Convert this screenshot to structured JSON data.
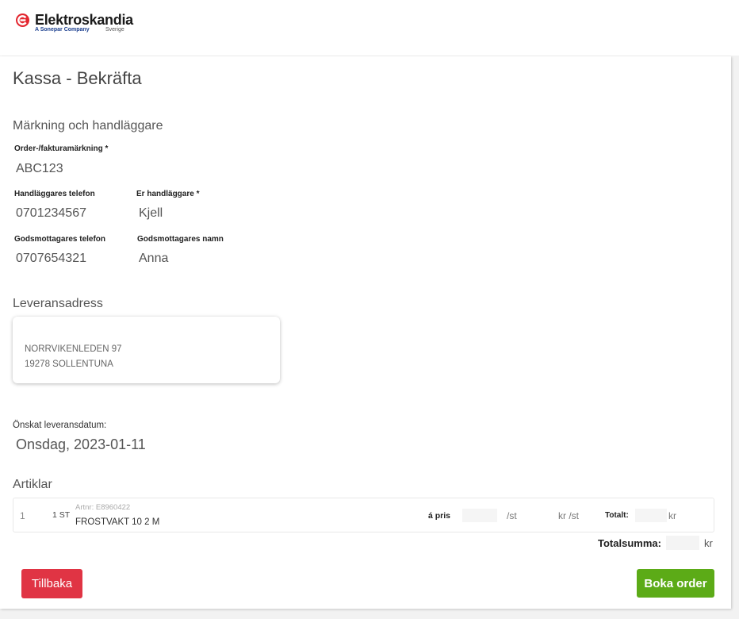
{
  "brand": {
    "name": "Elektroskandia",
    "tagline": "A Sonepar Company",
    "country": "Sverige",
    "colors": {
      "logo_red": "#e3262f",
      "tagline_blue": "#1b3f8f"
    }
  },
  "page": {
    "title": "Kassa - Bekräfta"
  },
  "marking_section": {
    "title": "Märkning och handläggare",
    "order_marking": {
      "label": "Order-/fakturamärkning *",
      "value": "ABC123"
    },
    "handler_phone": {
      "label": "Handläggares telefon",
      "value": "0701234567"
    },
    "handler_name": {
      "label": "Er handläggare *",
      "value": "Kjell"
    },
    "recipient_phone": {
      "label": "Godsmottagares telefon",
      "value": "0707654321"
    },
    "recipient_name": {
      "label": "Godsmottagares namn",
      "value": "Anna"
    }
  },
  "delivery_section": {
    "title": "Leveransadress",
    "address_line1": "NORRVIKENLEDEN 97",
    "address_line2": "19278 SOLLENTUNA"
  },
  "delivery_date": {
    "label": "Önskat leveransdatum:",
    "value": "Onsdag, 2023-01-11"
  },
  "articles_section": {
    "title": "Artiklar",
    "items": [
      {
        "index": "1",
        "quantity": "1 ST",
        "article_number": "Artnr: E8960422",
        "name": "FROSTVAKT 10 2 M",
        "unit_price_label": "á pris",
        "per_unit": "/st",
        "currency_per_unit": "kr /st",
        "total_label": "Totalt:",
        "total_currency": "kr"
      }
    ],
    "total_sum_label": "Totalsumma:",
    "total_sum_currency": "kr"
  },
  "actions": {
    "back_label": "Tillbaka",
    "book_label": "Boka order",
    "colors": {
      "back": "#e03444",
      "book": "#5cab17"
    }
  }
}
